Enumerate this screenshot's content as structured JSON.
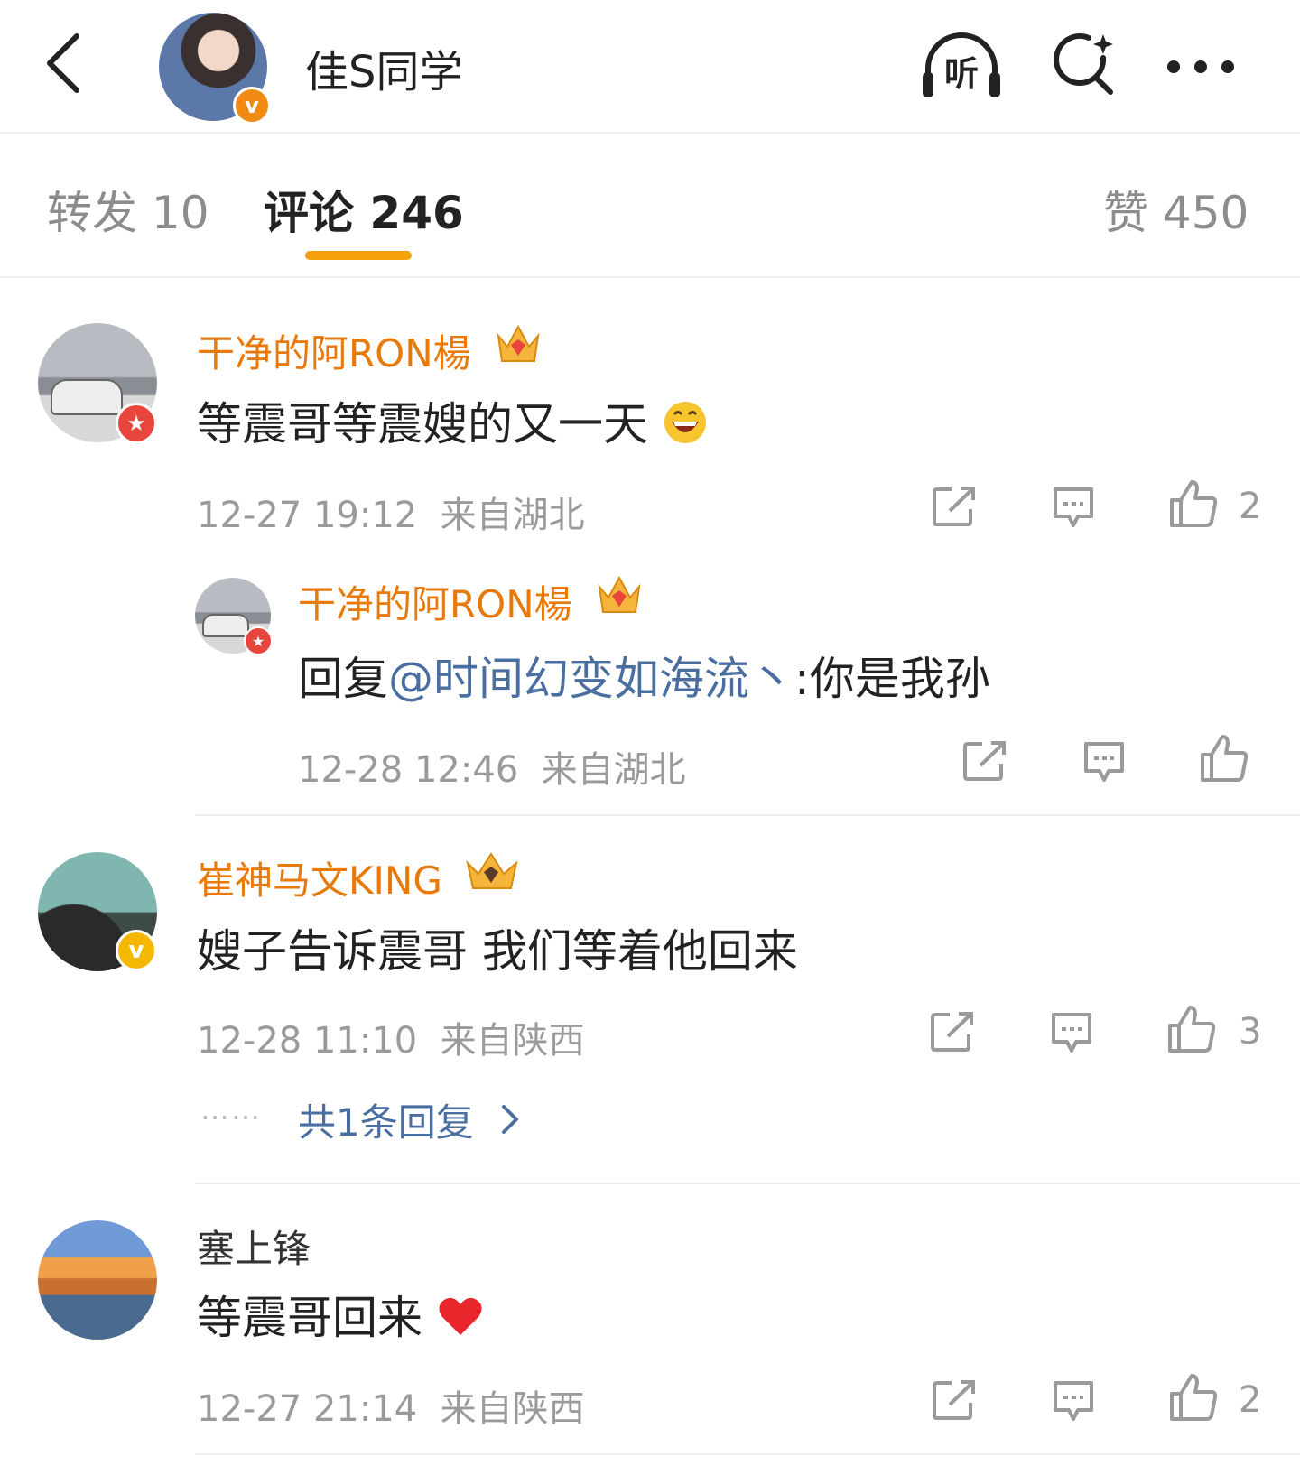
{
  "header": {
    "title": "佳S同学",
    "listen_label": "听",
    "badge_letter": "v"
  },
  "tabs": {
    "repost": "转发 10",
    "comment": "评论 246",
    "like": "赞 450"
  },
  "colors": {
    "accent": "#f5a10c",
    "username": "#e87a0c",
    "mention": "#4a6ea0",
    "meta": "#9a9a9a"
  },
  "comments": [
    {
      "user": "干净的阿RON楊",
      "text": "等震哥等震嫂的又一天",
      "emoji": "grinning-face",
      "time": "12-27 19:12",
      "location": "来自湖北",
      "likes": "2",
      "badge_letter": "★",
      "reply": {
        "user": "干净的阿RON楊",
        "prefix": "回复",
        "mention": "@时间幻变如海流丶",
        "text": ":你是我孙",
        "time": "12-28 12:46",
        "location": "来自湖北"
      }
    },
    {
      "user": "崔神马文KING",
      "text": "嫂子告诉震哥 我们等着他回来",
      "time": "12-28 11:10",
      "location": "来自陕西",
      "likes": "3",
      "badge_letter": "v",
      "more_dots": "……",
      "more_replies": "共1条回复"
    },
    {
      "user": "塞上锋",
      "text": "等震哥回来",
      "emoji": "red-heart",
      "time": "12-27 21:14",
      "location": "来自陕西",
      "likes": "2"
    }
  ]
}
